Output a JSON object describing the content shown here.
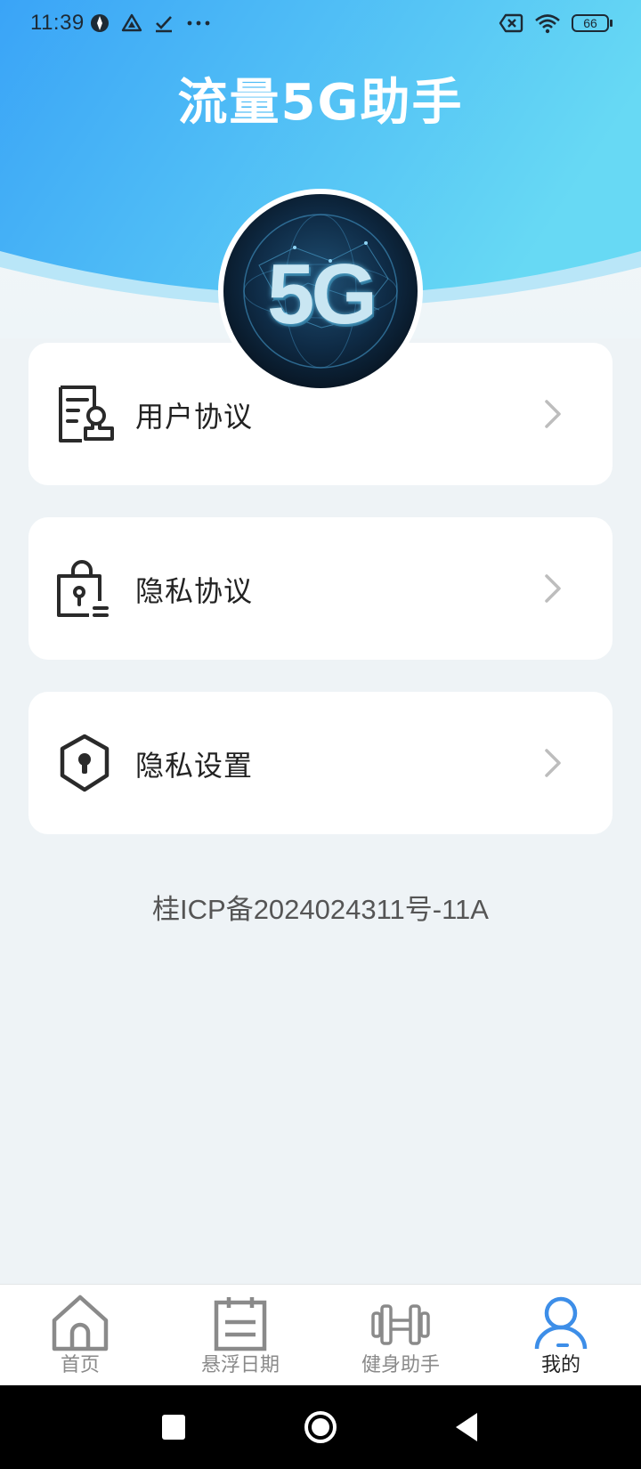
{
  "status_bar": {
    "time": "11:39",
    "battery": "66"
  },
  "app": {
    "title": "流量5G助手",
    "avatar_text": "5G"
  },
  "menu": [
    {
      "label": "用户协议",
      "icon": "user-agreement-icon"
    },
    {
      "label": "隐私协议",
      "icon": "privacy-lock-icon"
    },
    {
      "label": "隐私设置",
      "icon": "shield-keyhole-icon"
    }
  ],
  "footer": {
    "icp": "桂ICP备2024024311号-11A"
  },
  "bottom_nav": [
    {
      "label": "首页",
      "icon": "home-icon",
      "active": false
    },
    {
      "label": "悬浮日期",
      "icon": "calendar-icon",
      "active": false
    },
    {
      "label": "健身助手",
      "icon": "dumbbell-icon",
      "active": false
    },
    {
      "label": "我的",
      "icon": "user-icon",
      "active": true
    }
  ],
  "colors": {
    "header_gradient_start": "#3aa4f7",
    "header_gradient_end": "#67d9f4",
    "active_tab": "#3d8ee8",
    "inactive_tab": "#8a8a8a"
  }
}
